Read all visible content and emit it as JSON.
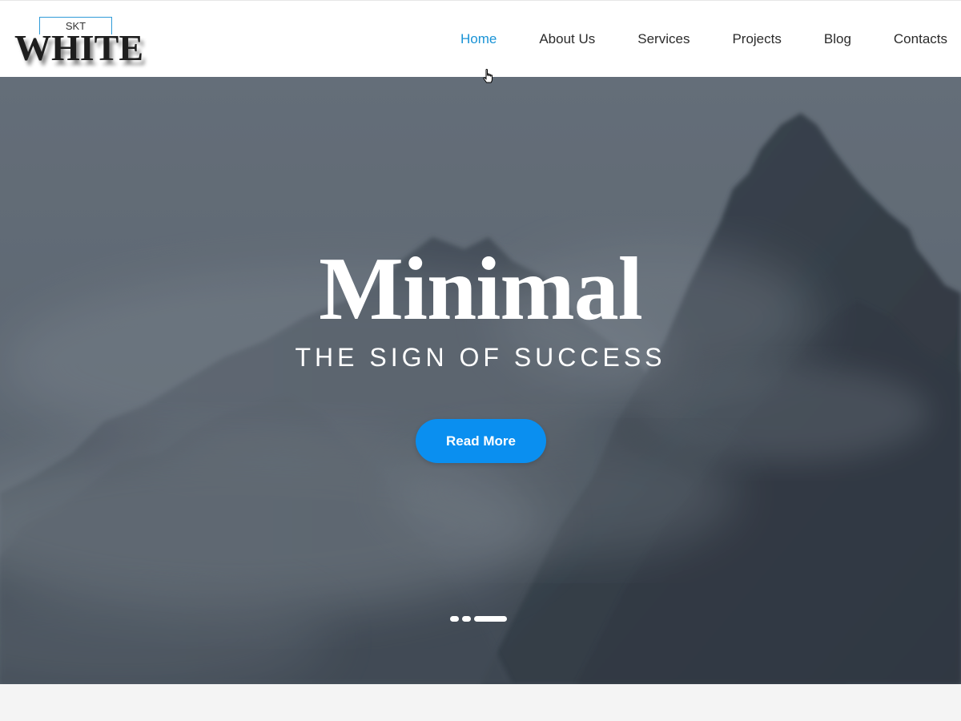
{
  "logo": {
    "small_text": "SKT",
    "big_text": "WHITE"
  },
  "nav": {
    "items": [
      {
        "label": "Home",
        "active": true
      },
      {
        "label": "About Us",
        "active": false
      },
      {
        "label": "Services",
        "active": false
      },
      {
        "label": "Projects",
        "active": false
      },
      {
        "label": "Blog",
        "active": false
      },
      {
        "label": "Contacts",
        "active": false
      }
    ]
  },
  "hero": {
    "title": "Minimal",
    "subtitle": "THE SIGN OF SUCCESS",
    "button_label": "Read More",
    "slides": 3,
    "active_slide": 3
  },
  "colors": {
    "accent": "#0a8ff0",
    "nav_active": "#1a93d6",
    "header_bg": "#ffffff",
    "hero_overlay": "#5c6773"
  },
  "icons": {
    "cursor": "hand-pointer-icon"
  }
}
